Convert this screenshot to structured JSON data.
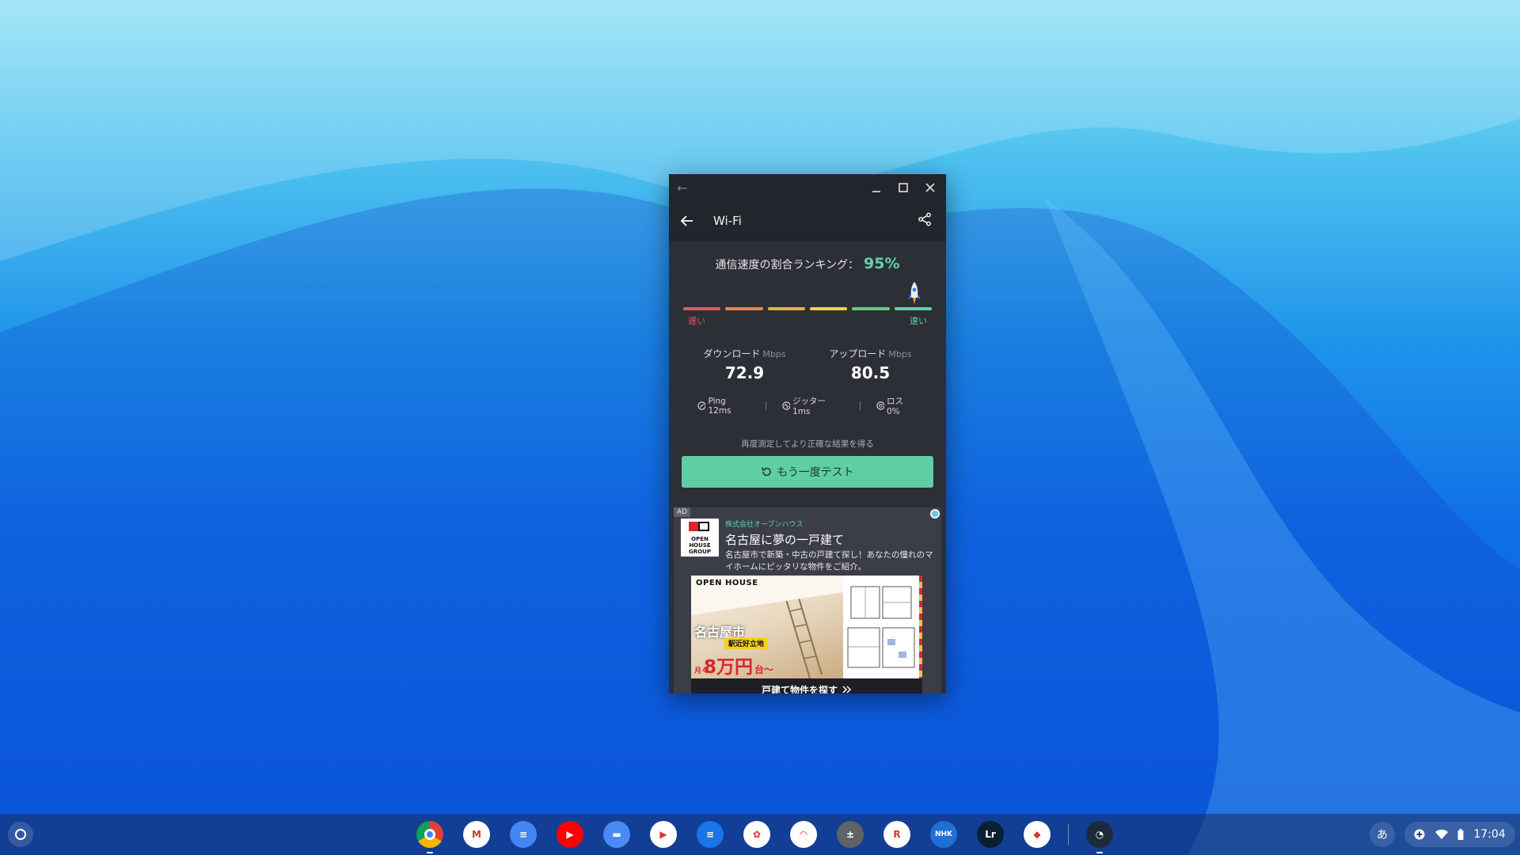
{
  "window": {
    "appbar_title": "Wi-Fi"
  },
  "ranking": {
    "label": "通信速度の割合ランキング：",
    "percent": "95%",
    "percent_value": 95,
    "slow_label": "遅い",
    "fast_label": "速い",
    "segment_colors": [
      "#e35a57",
      "#e8874a",
      "#e8b33a",
      "#e8d93c",
      "#5ecf7a",
      "#5fd4a6"
    ]
  },
  "download": {
    "label": "ダウンロード",
    "unit": "Mbps",
    "value": "72.9"
  },
  "upload": {
    "label": "アップロード",
    "unit": "Mbps",
    "value": "80.5"
  },
  "stats": {
    "ping": "Ping 12ms",
    "jitter": "ジッター 1ms",
    "loss": "ロス 0%"
  },
  "retest": {
    "hint": "再度測定してより正確な結果を得る",
    "button_label": "もう一度テスト"
  },
  "ad": {
    "tag": "AD",
    "company": "株式会社オープンハウス",
    "title": "名古屋に夢の一戸建て",
    "description": "名古屋市で新築・中古の戸建て探し！あなたの憧れのマイホームにピッタリな物件をご紹介。",
    "logo_text": "OPEN HOUSE GROUP",
    "banner": {
      "brand": "OPEN HOUSE",
      "city": "名古屋市",
      "badge": "駅近好立地",
      "price_prefix": "月々",
      "price": "8万円",
      "price_suffix": "台〜"
    },
    "cta": "戸建て物件を探す"
  },
  "shelf": {
    "apps": [
      {
        "name": "chrome-app-icon",
        "color": "#ffffff",
        "glyph": ""
      },
      {
        "name": "gmail-app-icon",
        "color": "#ffffff",
        "glyph": "M"
      },
      {
        "name": "docs-app-icon",
        "color": "#4285f4",
        "glyph": "≡"
      },
      {
        "name": "youtube-app-icon",
        "color": "#ff0000",
        "glyph": "▶"
      },
      {
        "name": "files-app-icon",
        "color": "#4a8af4",
        "glyph": "▬"
      },
      {
        "name": "play-store-app-icon",
        "color": "#ffffff",
        "glyph": "▶"
      },
      {
        "name": "messages-app-icon",
        "color": "#1a73e8",
        "glyph": "≡"
      },
      {
        "name": "wifi-map-app-icon",
        "color": "#ffffff",
        "glyph": "✿"
      },
      {
        "name": "wifi-app-icon",
        "color": "#ffffff",
        "glyph": "◠"
      },
      {
        "name": "calculator-app-icon",
        "color": "#5f6368",
        "glyph": "±"
      },
      {
        "name": "rakuten-app-icon",
        "color": "#ffffff",
        "glyph": "R"
      },
      {
        "name": "nhk-news-app-icon",
        "color": "#1f6fd6",
        "glyph": "NHK"
      },
      {
        "name": "lightroom-app-icon",
        "color": "#0b1f33",
        "glyph": "Lr"
      },
      {
        "name": "snapseed-app-icon",
        "color": "#ffffff",
        "glyph": "◆"
      },
      {
        "name": "speedtest-app-icon",
        "color": "#1d2a3a",
        "glyph": "◔"
      }
    ],
    "ime": "あ",
    "time": "17:04"
  }
}
